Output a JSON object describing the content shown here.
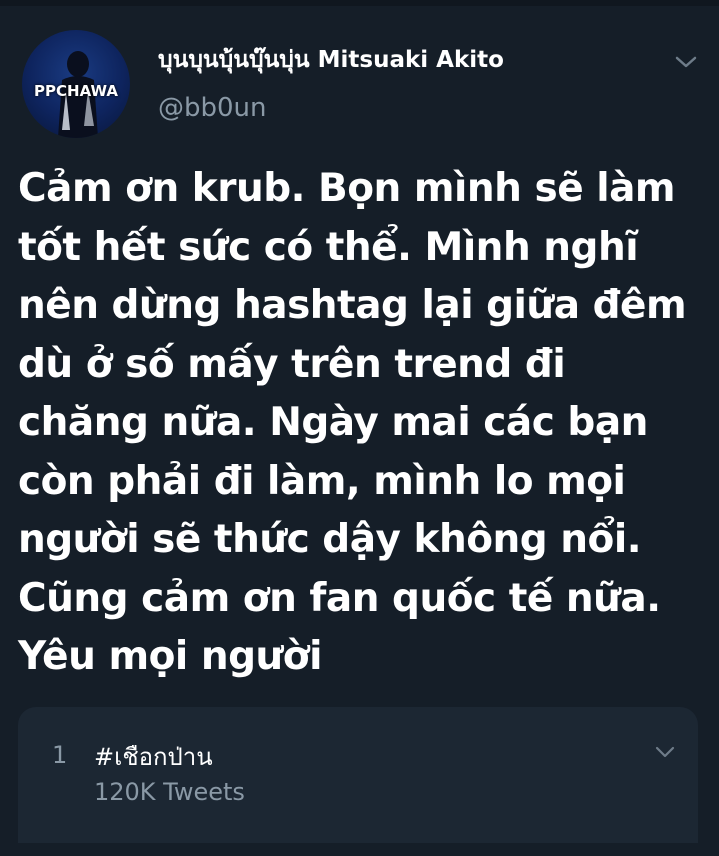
{
  "tweet": {
    "author": {
      "display_name": "บุนบุนบุ้นบุ๊นบุ่น Mitsuaki Akito",
      "handle": "@bb0un",
      "avatar_text": "PPCHAWA"
    },
    "text": "Cảm ơn krub. Bọn mình sẽ làm\ntốt hết sức có thể. Mình nghĩ\nnên dừng hashtag lại giữa đêm\ndù ở số mấy trên trend đi\nchăng nữa. Ngày mai các bạn\ncòn phải đi làm, mình lo mọi\nngười sẽ thức dậy không nổi.\nCũng cảm ơn fan quốc tế nữa.\nYêu mọi người",
    "menu_icon": "chevron-down-icon"
  },
  "trend": {
    "rank": "1",
    "hashtag": "#เชือกป่าน",
    "tweet_count": "120K Tweets",
    "menu_icon": "chevron-down-icon"
  },
  "colors": {
    "background": "#151e28",
    "card": "#1c2733",
    "secondary_text": "#8a99a6",
    "primary_text": "#ffffff"
  }
}
